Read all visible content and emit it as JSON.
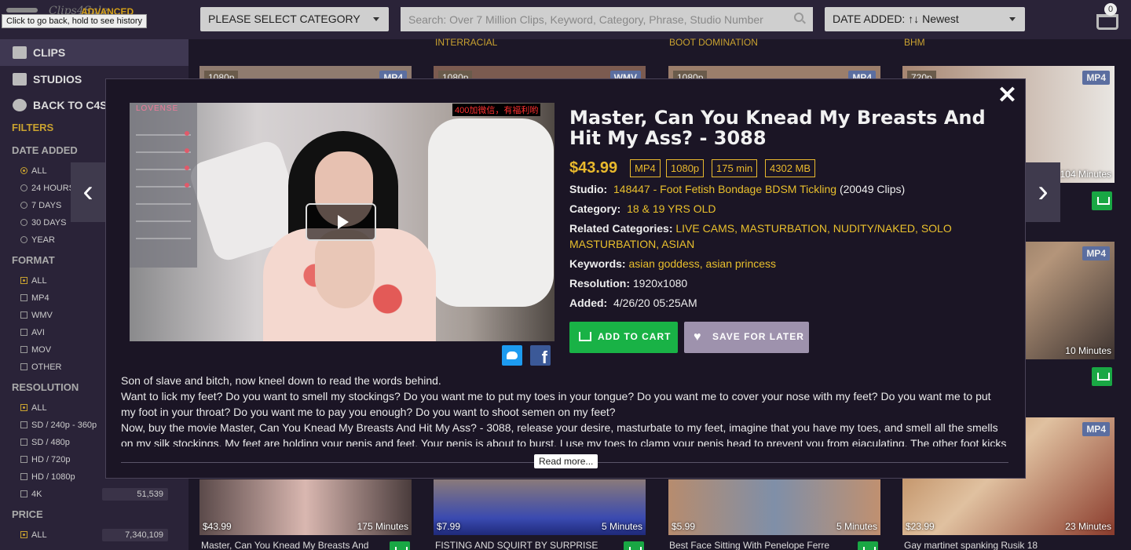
{
  "header": {
    "logo": "Clips4Sale",
    "advanced_label": "ADVANCED",
    "tooltip": "Click to go back, hold to see history",
    "category_select": "PLEASE SELECT CATEGORY",
    "search_placeholder": "Search: Over 7 Million Clips, Keyword, Category, Phrase, Studio Number",
    "sort_label": "DATE ADDED: ↑↓ Newest",
    "cart_count": "0"
  },
  "sidebar": {
    "nav": [
      {
        "label": "CLIPS"
      },
      {
        "label": "STUDIOS"
      },
      {
        "label": "BACK TO C4S"
      }
    ],
    "filters_label": "FILTERS",
    "date_added": {
      "label": "DATE ADDED",
      "options": [
        "ALL",
        "24 HOURS",
        "7 DAYS",
        "30 DAYS",
        "YEAR"
      ],
      "selected": "ALL"
    },
    "format": {
      "label": "FORMAT",
      "options": [
        "ALL",
        "MP4",
        "WMV",
        "AVI",
        "MOV",
        "OTHER"
      ],
      "selected": "ALL"
    },
    "resolution": {
      "label": "RESOLUTION",
      "options": [
        "ALL",
        "SD / 240p - 360p",
        "SD / 480p",
        "HD / 720p",
        "HD / 1080p",
        "4K"
      ],
      "selected": "ALL",
      "counts": {
        "4K": "51,539"
      }
    },
    "price": {
      "label": "PRICE",
      "options": [
        "ALL"
      ],
      "selected": "ALL",
      "counts": {
        "ALL": "7,340,109"
      }
    }
  },
  "grid": {
    "column_labels": [
      "INTERRACIAL",
      "BOOT DOMINATION",
      "BHM"
    ],
    "top_row_badges": [
      {
        "res": "1080p",
        "fmt": "MP4"
      },
      {
        "res": "1080p",
        "fmt": "WMV"
      },
      {
        "res": "1080p",
        "fmt": "MP4"
      },
      {
        "res": "720p",
        "fmt": "MP4"
      }
    ],
    "right_column": [
      {
        "fmt": "MP4",
        "duration": "104 Minutes"
      },
      {
        "fmt": "MP4",
        "duration": "10 Minutes"
      },
      {
        "fmt": "MP4"
      }
    ],
    "bottom_row": [
      {
        "price": "$43.99",
        "duration": "175 Minutes",
        "title": "Master, Can You Knead My Breasts And"
      },
      {
        "price": "$7.99",
        "duration": "5 Minutes",
        "title": "FISTING AND SQUIRT BY SURPRISE"
      },
      {
        "price": "$5.99",
        "duration": "5 Minutes",
        "title": "Best Face Sitting With Penelope Ferre"
      },
      {
        "price": "$23.99",
        "duration": "23 Minutes",
        "title": "Gay martinet spanking Rusik 18"
      }
    ]
  },
  "modal": {
    "close": "✕",
    "video_logo": "LOVENSE",
    "video_overlay_text": "400加微信，有福利哟",
    "title": "Master, Can You Knead My Breasts And Hit My Ass? - 3088",
    "price": "$43.99",
    "tags": [
      "MP4",
      "1080p",
      "175 min",
      "4302 MB"
    ],
    "studio_label": "Studio:",
    "studio_value": "148447 - Foot Fetish Bondage BDSM Tickling",
    "studio_count": "(20049 Clips)",
    "category_label": "Category:",
    "category_value": "18 & 19 YRS OLD",
    "related_label": "Related Categories:",
    "related_value": "LIVE CAMS, MASTURBATION, NUDITY/NAKED, SOLO MASTURBATION, ASIAN",
    "keywords_label": "Keywords:",
    "keywords_value": "asian goddess, asian princess",
    "resolution_label": "Resolution:",
    "resolution_value": "1920x1080",
    "added_label": "Added:",
    "added_value": "4/26/20 05:25AM",
    "add_to_cart": "ADD TO CART",
    "save_for_later": "SAVE FOR LATER",
    "description": [
      "Son of slave and bitch, now kneel down to read the words behind.",
      "Want to lick my feet? Do you want to smell my stockings? Do you want me to put my toes in your tongue? Do you want me to cover your nose with my feet? Do you want me to put my foot in your throat? Do you want me to pay you enough? Do you want to shoot semen on my feet?",
      "Now, buy the movie Master, Can You Knead My Breasts And Hit My Ass? - 3088, release your desire, masturbate to my feet, imagine that you have my toes, and smell all the smells on my silk stockings. My feet are holding your penis and feet. Your penis is about to burst. I use my toes to clamp your penis head to prevent you from ejaculating. The other foot kicks"
    ],
    "read_more": "Read more...",
    "prev_arrow": "‹",
    "next_arrow": "›"
  }
}
